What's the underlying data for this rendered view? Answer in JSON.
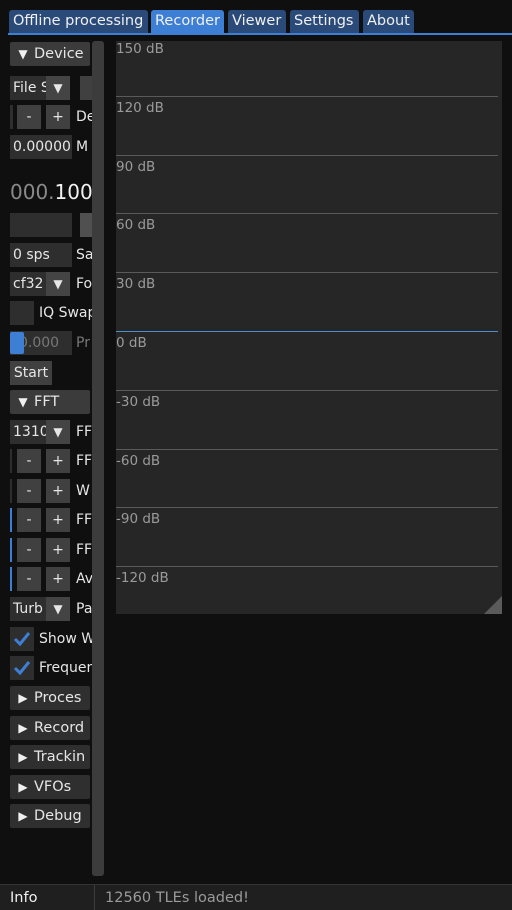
{
  "tabs": [
    "Offline processing",
    "Recorder",
    "Viewer",
    "Settings",
    "About"
  ],
  "active_tab": "Recorder",
  "device": {
    "header": "Device",
    "source_select": "File S",
    "gain_label": "De",
    "minus": "-",
    "plus": "+",
    "value_field": "0.00000",
    "value_label": "M",
    "frequency_dim": "000.",
    "frequency_bright": "100",
    "samplerate_field": "0 sps",
    "samplerate_label": "Sa",
    "format_select": "cf32",
    "format_label": "Fo",
    "iq_swap_label": "IQ Swap",
    "progress_field": "0.000",
    "progress_label": "Pr",
    "start_button": "Start"
  },
  "fft": {
    "header": "FFT",
    "size_select": "1310",
    "size_label": "FF",
    "rows": [
      {
        "label": "FF"
      },
      {
        "label": "W"
      },
      {
        "label": "FF"
      },
      {
        "label": "FF"
      },
      {
        "label": "Av"
      }
    ],
    "palette_select": "Turb",
    "palette_label": "Pa",
    "show_waterfall_label": "Show W",
    "frequency_scale_label": "Frequen"
  },
  "sections": [
    "Proces",
    "Record",
    "Trackin",
    "VFOs",
    "Debug"
  ],
  "plot": {
    "db_labels": [
      "150 dB",
      "120 dB",
      "90 dB",
      "60 dB",
      "30 dB",
      "0 dB",
      "-30 dB",
      "-60 dB",
      "-90 dB",
      "-120 dB"
    ],
    "zero_line_color": "#4b8fcf"
  },
  "status": {
    "title": "Info",
    "message": "12560 TLEs loaded!"
  },
  "colors": {
    "accent": "#3d7fd4",
    "tab_inactive": "#2a4a7a",
    "background": "#0f0f0f"
  }
}
